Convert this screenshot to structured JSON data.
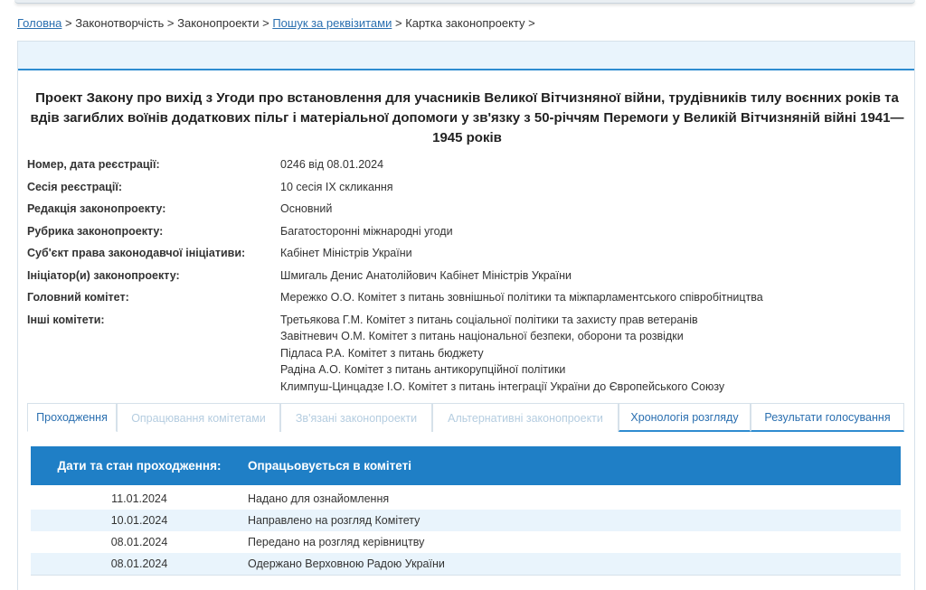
{
  "breadcrumb": {
    "home": "Головна",
    "lawmaking": "Законотворчість",
    "bills": "Законопроекти",
    "search": "Пошук за реквізитами",
    "card": "Картка законопроекту",
    "sep": ">"
  },
  "bill": {
    "title": "Проект Закону про вихід з Угоди про встановлення для учасників Великої Вітчизняної війни, трудівників тилу воєнних років та вдів загиблих воїнів додаткових пільг і матеріальної допомоги у зв'язку з 50-річчям Перемоги у Великій Вітчизняній війні 1941—1945 років",
    "fields": [
      {
        "label": "Номер, дата реєстрації:",
        "value": "0246 від 08.01.2024"
      },
      {
        "label": "Сесія реєстрації:",
        "value": "10 сесія IX скликання"
      },
      {
        "label": "Редакція законопроекту:",
        "value": "Основний"
      },
      {
        "label": "Рубрика законопроекту:",
        "value": "Багатосторонні міжнародні угоди"
      },
      {
        "label": "Суб'єкт права законодавчої ініціативи:",
        "value": "Кабінет Міністрів України"
      },
      {
        "label": "Ініціатор(и) законопроекту:",
        "value": "Шмигаль Денис Анатолійович Кабінет Міністрів України"
      },
      {
        "label": "Головний комітет:",
        "value": "Мережко О.О. Комітет з питань зовнішньої політики та міжпарламентського співробітництва"
      }
    ],
    "other_committees_label": "Інші комітети:",
    "other_committees": [
      "Третьякова Г.М. Комітет з питань соціальної політики та захисту прав ветеранів",
      "Завітневич О.М. Комітет з питань національної безпеки, оборони та розвідки",
      "Підласа Р.А. Комітет з питань бюджету",
      "Радіна А.О. Комітет з питань антикорупційної політики",
      "Климпуш-Цинцадзе І.О. Комітет з питань інтеграції України до Європейського Союзу"
    ]
  },
  "tabs": [
    {
      "label": "Проходження",
      "state": "active"
    },
    {
      "label": "Опрацювання комітетами",
      "state": "disabled"
    },
    {
      "label": "Зв'язані законопроекти",
      "state": "disabled"
    },
    {
      "label": "Альтернативні законопроекти",
      "state": "disabled"
    },
    {
      "label": "Хронологія розгляду",
      "state": "enabled"
    },
    {
      "label": "Результати голосування",
      "state": "enabled"
    }
  ],
  "passage": {
    "header_dates": "Дати та стан проходження:",
    "header_status": "Опрацьовується в комітеті",
    "rows": [
      {
        "date": "11.01.2024",
        "event": "Надано для ознайомлення"
      },
      {
        "date": "10.01.2024",
        "event": "Направлено на розгляд Комітету"
      },
      {
        "date": "08.01.2024",
        "event": "Передано на розгляд керівництву"
      },
      {
        "date": "08.01.2024",
        "event": "Одержано Верховною Радою України"
      }
    ]
  },
  "colors": {
    "accent": "#1f7fc6",
    "link": "#2a6fb0",
    "row_alt": "#e9f4fc"
  }
}
